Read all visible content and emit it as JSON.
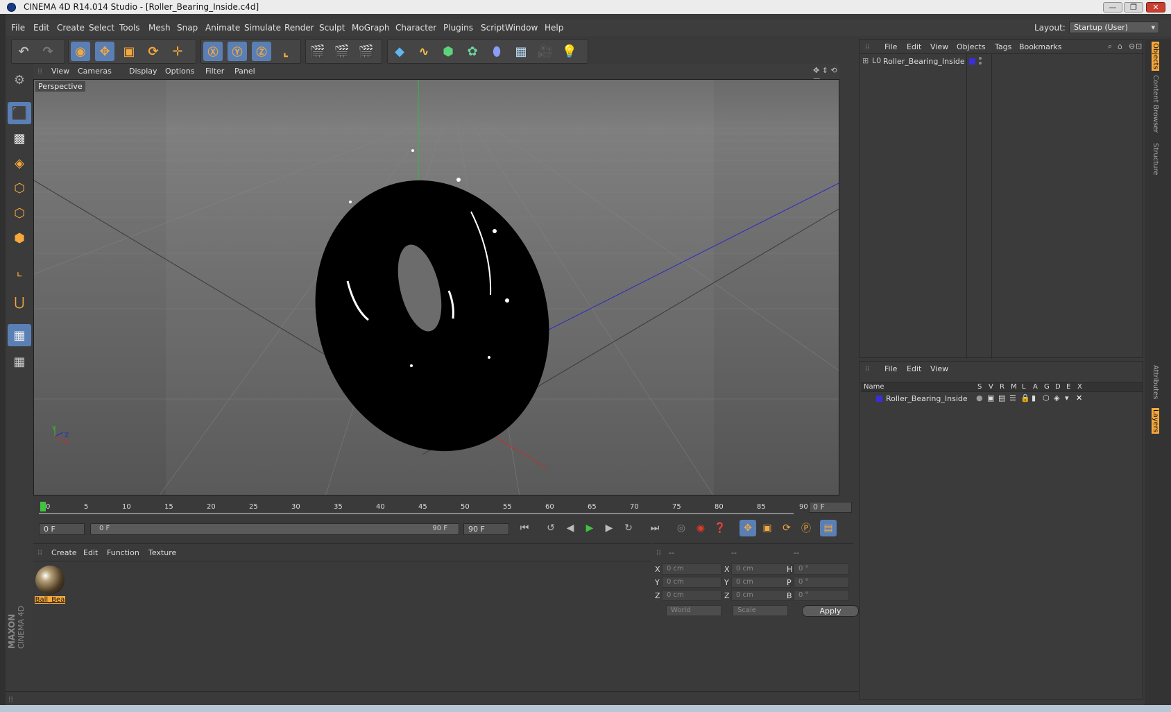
{
  "window": {
    "title": "CINEMA 4D R14.014 Studio - [Roller_Bearing_Inside.c4d]"
  },
  "menubar": {
    "items": [
      "File",
      "Edit",
      "Create",
      "Select",
      "Tools",
      "Mesh",
      "Snap",
      "Animate",
      "Simulate",
      "Render",
      "Sculpt",
      "MoGraph",
      "Character",
      "Plugins",
      "Script",
      "Window",
      "Help"
    ],
    "layout_label": "Layout:",
    "layout_value": "Startup (User)"
  },
  "viewport": {
    "menu": [
      "View",
      "Cameras",
      "Display",
      "Options",
      "Filter",
      "Panel"
    ],
    "label": "Perspective",
    "axis_labels": {
      "y": "Y",
      "z": "Z",
      "x": "X"
    }
  },
  "timeline": {
    "ticks": [
      "0",
      "5",
      "10",
      "15",
      "20",
      "25",
      "30",
      "35",
      "40",
      "45",
      "50",
      "55",
      "60",
      "65",
      "70",
      "75",
      "80",
      "85",
      "90"
    ],
    "current_frame": "0 F"
  },
  "transport": {
    "start_field": "0 F",
    "range_start": "0 F",
    "range_end": "90 F",
    "end_field": "90 F"
  },
  "material_manager": {
    "menu": [
      "Create",
      "Edit",
      "Function",
      "Texture"
    ],
    "materials": [
      {
        "name": "Ball_Bea"
      }
    ]
  },
  "coord_manager": {
    "headers": [
      "--",
      "--",
      "--"
    ],
    "rows": [
      {
        "a": "X",
        "a_val": "0 cm",
        "b": "X",
        "b_val": "0 cm",
        "c": "H",
        "c_val": "0 °"
      },
      {
        "a": "Y",
        "a_val": "0 cm",
        "b": "Y",
        "b_val": "0 cm",
        "c": "P",
        "c_val": "0 °"
      },
      {
        "a": "Z",
        "a_val": "0 cm",
        "b": "Z",
        "b_val": "0 cm",
        "c": "B",
        "c_val": "0 °"
      }
    ],
    "world_select": "World",
    "scale_select": "Scale",
    "apply_label": "Apply"
  },
  "object_manager": {
    "menu": [
      "File",
      "Edit",
      "View",
      "Objects",
      "Tags",
      "Bookmarks"
    ],
    "objects": [
      {
        "name": "Roller_Bearing_Inside",
        "color": "#3a2fd8"
      }
    ]
  },
  "layer_manager": {
    "menu": [
      "File",
      "Edit",
      "View"
    ],
    "columns": [
      "Name",
      "S",
      "V",
      "R",
      "M",
      "L",
      "A",
      "G",
      "D",
      "E",
      "X"
    ],
    "layers": [
      {
        "name": "Roller_Bearing_Inside",
        "color": "#3a2fd8"
      }
    ]
  },
  "right_tabs": [
    "Objects",
    "Content Browser",
    "Structure",
    "Attributes",
    "Layers"
  ],
  "brand": {
    "maxon": "MAXON",
    "product": "CINEMA 4D"
  },
  "colors": {
    "accent": "#5a7fb5",
    "tool_orange": "#f6a83c",
    "play_green": "#3ec43e"
  }
}
